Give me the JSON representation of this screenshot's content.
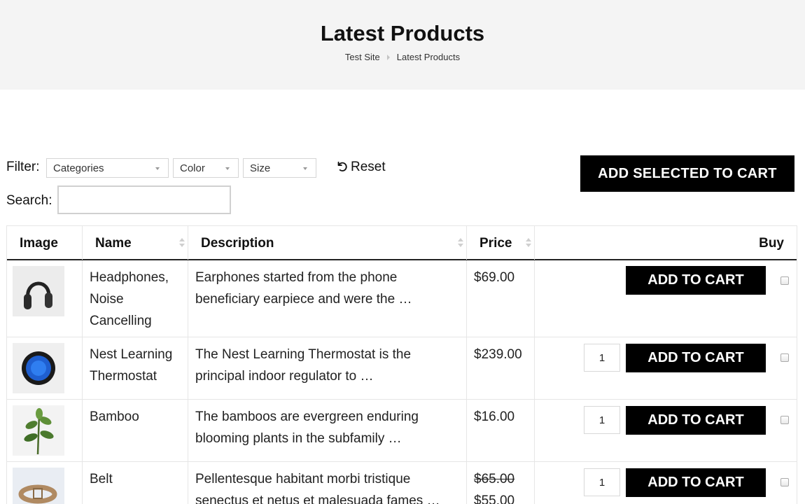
{
  "header": {
    "title": "Latest Products",
    "breadcrumb": [
      "Test Site",
      "Latest Products"
    ]
  },
  "filters": {
    "label": "Filter:",
    "selects": [
      {
        "value": "Categories"
      },
      {
        "value": "Color"
      },
      {
        "value": "Size"
      }
    ],
    "reset_label": "Reset",
    "search_label": "Search:",
    "search_value": ""
  },
  "add_selected_label": "ADD SELECTED TO CART",
  "table": {
    "columns": [
      "Image",
      "Name",
      "Description",
      "Price",
      "Buy"
    ],
    "rows": [
      {
        "image_icon": "headphones-image",
        "name": "Headphones, Noise Cancelling",
        "description": "Earphones started from the phone beneficiary earpiece and were the …",
        "price": "$69.00",
        "old_price": "",
        "has_qty": false,
        "qty": "",
        "button": "ADD TO CART"
      },
      {
        "image_icon": "thermostat-image",
        "name": "Nest Learning Thermostat",
        "description": "The Nest Learning Thermostat is the principal indoor regulator to …",
        "price": "$239.00",
        "old_price": "",
        "has_qty": true,
        "qty": "1",
        "button": "ADD TO CART"
      },
      {
        "image_icon": "bamboo-plant-image",
        "name": "Bamboo",
        "description": "The bamboos are evergreen enduring blooming plants in the subfamily …",
        "price": "$16.00",
        "old_price": "",
        "has_qty": true,
        "qty": "1",
        "button": "ADD TO CART"
      },
      {
        "image_icon": "belt-image",
        "name": "Belt",
        "description": "Pellentesque habitant morbi tristique senectus et netus et malesuada fames …",
        "price": "$55.00",
        "old_price": "$65.00",
        "has_qty": true,
        "qty": "1",
        "button": "ADD TO CART"
      }
    ]
  },
  "colors": {
    "button_bg": "#000000",
    "header_bg": "#f4f4f4"
  }
}
